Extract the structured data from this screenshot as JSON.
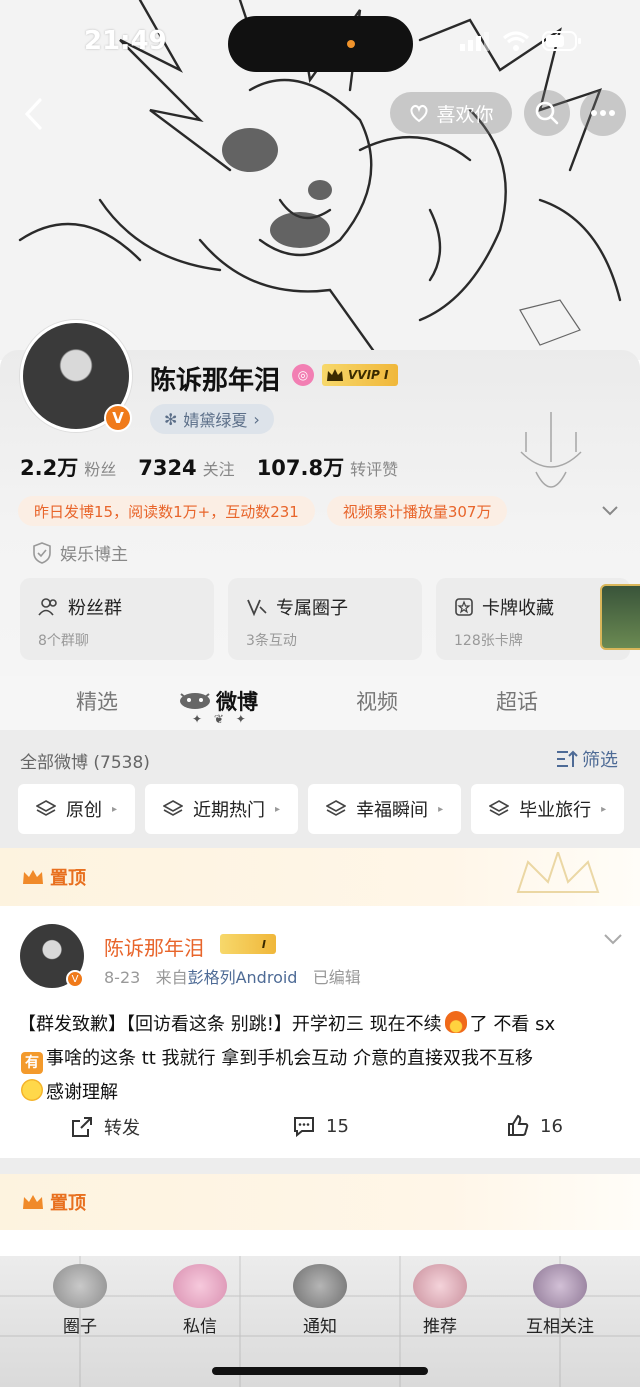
{
  "status_bar": {
    "time": "21:49"
  },
  "header": {
    "like_label": "喜欢你"
  },
  "profile": {
    "name": "陈诉那年泪",
    "vip_label": "VVIP I",
    "v_badge": "V",
    "tag": "婧黛绿夏",
    "stats": [
      {
        "value": "2.2万",
        "label": "粉丝"
      },
      {
        "value": "7324",
        "label": "关注"
      },
      {
        "value": "107.8万",
        "label": "转评赞"
      }
    ],
    "highlights": [
      "昨日发博15，阅读数1万+，互动数231",
      "视频累计播放量307万"
    ],
    "role": "娱乐博主"
  },
  "cards": [
    {
      "title": "粉丝群",
      "sub": "8个群聊"
    },
    {
      "title": "专属圈子",
      "sub": "3条互动"
    },
    {
      "title": "卡牌收藏",
      "sub": "128张卡牌"
    }
  ],
  "tabs": [
    "精选",
    "微博",
    "视频",
    "超话"
  ],
  "feed": {
    "all_label": "全部微博 (7538)",
    "filter_label": "筛选",
    "chips": [
      "原创",
      "近期热门",
      "幸福瞬间",
      "毕业旅行"
    ],
    "pinned_label": "置顶"
  },
  "post": {
    "author": "陈诉那年泪",
    "vip_label": "I",
    "date": "8-23",
    "from_prefix": "来自",
    "source": "彭格列Android",
    "edited": "已编辑",
    "text_1": "【群发致歉】【回访看这条 别跳!】开学初三 现在不续",
    "text_2": "了 不看 sx",
    "text_3": "事啥的这条 tt 我就行 拿到手机会互动 介意的直接双我不互移",
    "text_4": "感谢理解",
    "emoji_badge": "有",
    "repost_label": "转发",
    "comments": "15",
    "likes": "16"
  },
  "tabbar": [
    "圈子",
    "私信",
    "通知",
    "推荐",
    "互相关注"
  ],
  "colors": {
    "accent_orange": "#e8652b",
    "link_blue": "#4e6b96",
    "vip_gold": "#f0b73a"
  }
}
